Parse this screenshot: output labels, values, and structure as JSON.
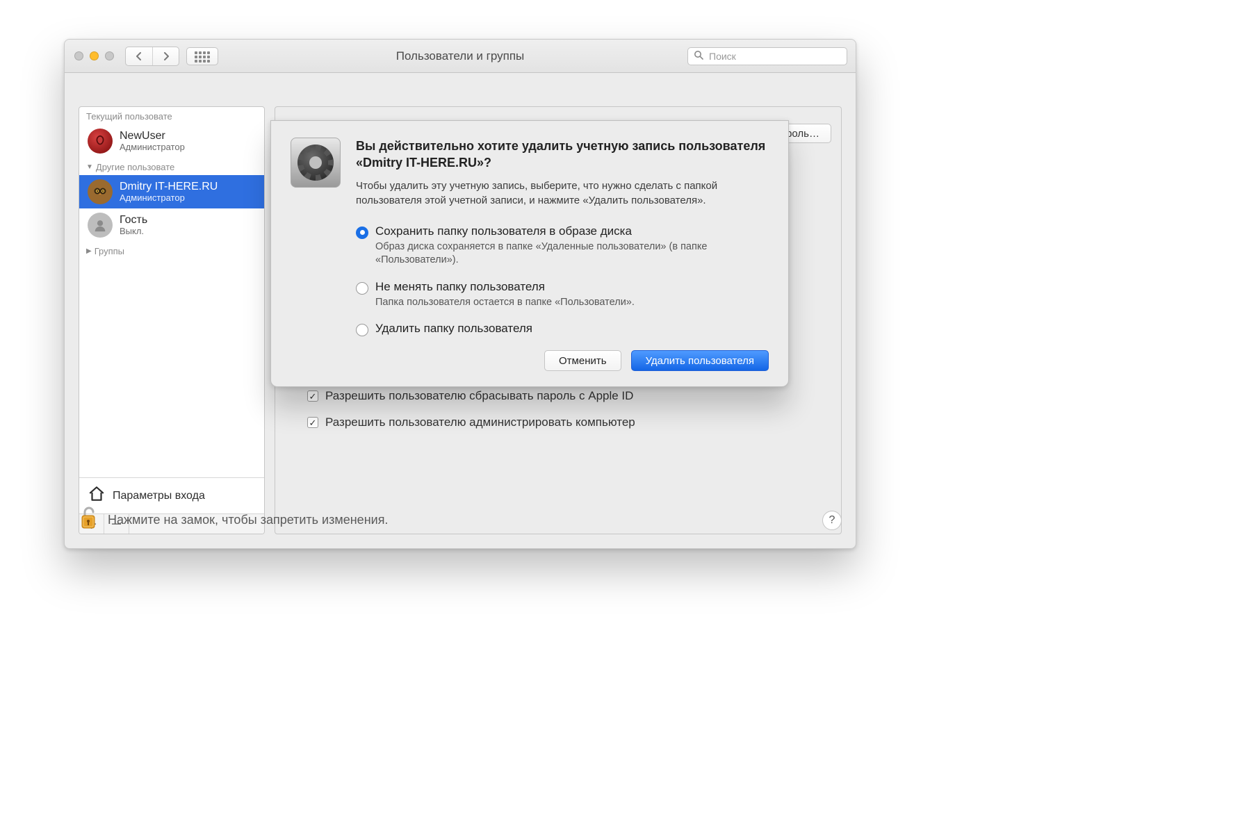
{
  "window": {
    "title": "Пользователи и группы",
    "search_placeholder": "Поиск"
  },
  "sidebar": {
    "current_header": "Текущий пользовате",
    "others_header": "Другие пользовате",
    "groups_header": "Группы",
    "login_options": "Параметры входа",
    "users": [
      {
        "name": "NewUser",
        "role": "Администратор"
      },
      {
        "name": "Dmitry IT-HERE.RU",
        "role": "Администратор"
      },
      {
        "name": "Гость",
        "role": "Выкл."
      }
    ]
  },
  "main": {
    "reset_password_button": "сить пароль…",
    "allow_reset_with_apple_id": "Разрешить пользователю сбрасывать пароль с Apple ID",
    "allow_admin": "Разрешить пользователю администрировать компьютер"
  },
  "lock_hint": "Нажмите на замок, чтобы запретить изменения.",
  "dialog": {
    "title": "Вы действительно хотите удалить учетную запись пользователя «Dmitry IT-HERE.RU»?",
    "subtitle": "Чтобы удалить эту учетную запись, выберите, что нужно сделать с папкой пользователя этой учетной записи, и нажмите «Удалить пользователя».",
    "options": [
      {
        "label": "Сохранить папку пользователя в образе диска",
        "desc": "Образ диска сохраняется в папке «Удаленные пользователи» (в папке «Пользователи»).",
        "selected": true
      },
      {
        "label": "Не менять папку пользователя",
        "desc": "Папка пользователя остается в папке «Пользователи».",
        "selected": false
      },
      {
        "label": "Удалить папку пользователя",
        "desc": "",
        "selected": false
      }
    ],
    "cancel": "Отменить",
    "confirm": "Удалить пользователя"
  }
}
